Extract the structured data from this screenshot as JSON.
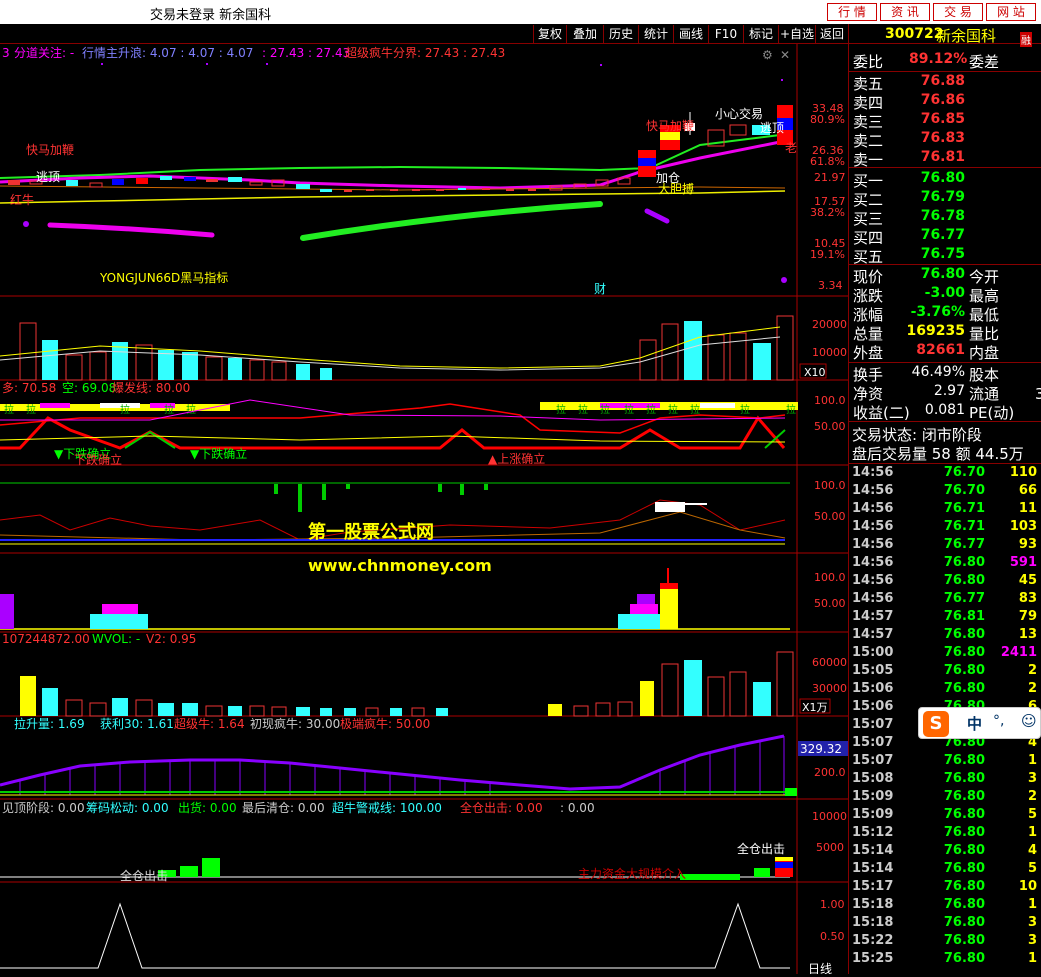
{
  "window": {
    "title": "交易未登录  新余国科",
    "top_buttons": [
      "行 情",
      "资 讯",
      "交 易",
      "网 站"
    ]
  },
  "toolbar": {
    "buttons": [
      "复权",
      "叠加",
      "历史",
      "统计",
      "画线",
      "F10",
      "标记",
      "+自选",
      "返回"
    ]
  },
  "panel1": {
    "legend_num": "3",
    "legend_a": "分道关注: -",
    "legend_b": "行情主升浪: 4.07 : 4.07 : 4.07",
    "legend_c": ": 27.43 : 27.43",
    "legend_d": "超级疯牛分界: 27.43 : 27.43",
    "axis": [
      "33.48",
      "80.9%",
      "26.36",
      "61.8%",
      "21.97",
      "17.57",
      "38.2%",
      "10.45",
      "19.1%",
      "3.34"
    ],
    "indicator_name": "YONGJUN66D黑马指标",
    "cai": "财",
    "annotations": {
      "kuaima_left": "快马加鞭",
      "taoding_left": "逃顶",
      "hongniu": "红牛",
      "kuaima_right": "快马加鞭",
      "xiaoxin": "小心交易",
      "taoding_right": "逃顶",
      "jiacang": "加仓",
      "dadanbo": "大胆搏",
      "lao": "老"
    }
  },
  "panel2": {
    "axis": [
      "20000",
      "10000"
    ],
    "unit": "X10"
  },
  "panel3": {
    "legend_a": "多: 70.58",
    "legend_b": "空: 69.08",
    "legend_c": "爆发线: 80.00",
    "axis": [
      "100.0",
      "50.00"
    ],
    "tag_la": "拉",
    "down_a": "下跌确立",
    "down_b": "下跌确立",
    "down_c": "下跌确立",
    "up_a": "上涨确立"
  },
  "panel4": {
    "axis": [
      "100.0",
      "50.00"
    ],
    "watermark_a": "第一股票公式网",
    "watermark_b": "www.chnmoney.com"
  },
  "panel5": {
    "axis": [
      "100.0",
      "50.00"
    ]
  },
  "panel6": {
    "legend_a": "107244872.00",
    "legend_b": "WVOL: -",
    "legend_c": "V2: 0.95",
    "axis": [
      "60000",
      "30000"
    ],
    "unit": "X1万"
  },
  "panel7": {
    "legend_a": "拉升量: 1.69",
    "legend_b": "获利30: 1.61",
    "legend_c": "超级牛: 1.64",
    "legend_d": "初现疯牛: 30.00",
    "legend_e": "极端疯牛: 50.00",
    "axis_box": "329.32",
    "axis": [
      "200.0"
    ]
  },
  "panel8": {
    "legend_a": "见顶阶段: 0.00",
    "legend_b": "筹码松动: 0.00",
    "legend_c": "出货: 0.00",
    "legend_d": "最后清仓: 0.00",
    "legend_e": "超牛警戒线: 100.00",
    "legend_f": "全仓出击: 0.00",
    "legend_g": ": 0.00",
    "axis": [
      "10000",
      "5000"
    ],
    "quancang_left": "全仓出击",
    "quancang_right": "全仓出击",
    "zhuli": "主力资金大规模介入"
  },
  "panel9": {
    "axis": [
      "1.00",
      "0.50"
    ],
    "corner": "日线"
  },
  "quote": {
    "code": "300722",
    "name": "新余国科",
    "badge": "融",
    "weibi_label": "委比",
    "weibi_val": "89.12%",
    "weicha_label": "委差",
    "asks": [
      {
        "label": "卖五",
        "price": "76.88"
      },
      {
        "label": "卖四",
        "price": "76.86"
      },
      {
        "label": "卖三",
        "price": "76.85"
      },
      {
        "label": "卖二",
        "price": "76.83"
      },
      {
        "label": "卖一",
        "price": "76.81"
      }
    ],
    "bids": [
      {
        "label": "买一",
        "price": "76.80"
      },
      {
        "label": "买二",
        "price": "76.79"
      },
      {
        "label": "买三",
        "price": "76.78"
      },
      {
        "label": "买四",
        "price": "76.77"
      },
      {
        "label": "买五",
        "price": "76.75"
      }
    ],
    "stats": [
      {
        "l1": "现价",
        "v1": "76.80",
        "l2": "今开",
        "color": "#0f0"
      },
      {
        "l1": "涨跌",
        "v1": "-3.00",
        "l2": "最高",
        "color": "#0f0"
      },
      {
        "l1": "涨幅",
        "v1": "-3.76%",
        "l2": "最低",
        "color": "#0f0"
      },
      {
        "l1": "总量",
        "v1": "169235",
        "l2": "量比",
        "color": "#ff0"
      },
      {
        "l1": "外盘",
        "v1": "82661",
        "l2": "内盘",
        "color": "#f33"
      }
    ],
    "stats2": [
      {
        "l1": "换手",
        "v1": "46.49%",
        "l2": "股本"
      },
      {
        "l1": "净资",
        "v1": "2.97",
        "l2": "流通"
      },
      {
        "l1": "收益(二)",
        "v1": "0.081",
        "l2": "PE(动)"
      }
    ],
    "liutong_extra": "3",
    "trade_status": "交易状态: 闭市阶段",
    "after_hours": "盘后交易量 58 额 44.5万"
  },
  "ticks": [
    {
      "t": "14:56",
      "p": "76.70",
      "v": "110",
      "vc": "#ff0"
    },
    {
      "t": "14:56",
      "p": "76.70",
      "v": "66",
      "vc": "#ff0"
    },
    {
      "t": "14:56",
      "p": "76.71",
      "v": "11",
      "vc": "#ff0"
    },
    {
      "t": "14:56",
      "p": "76.71",
      "v": "103",
      "vc": "#ff0"
    },
    {
      "t": "14:56",
      "p": "76.77",
      "v": "93",
      "vc": "#ff0"
    },
    {
      "t": "14:56",
      "p": "76.80",
      "v": "591",
      "vc": "#f0f"
    },
    {
      "t": "14:56",
      "p": "76.80",
      "v": "45",
      "vc": "#ff0"
    },
    {
      "t": "14:56",
      "p": "76.77",
      "v": "83",
      "vc": "#ff0"
    },
    {
      "t": "14:57",
      "p": "76.81",
      "v": "79",
      "vc": "#ff0"
    },
    {
      "t": "14:57",
      "p": "76.80",
      "v": "13",
      "vc": "#ff0"
    },
    {
      "t": "15:00",
      "p": "76.80",
      "v": "2411",
      "vc": "#f0f"
    },
    {
      "t": "15:05",
      "p": "76.80",
      "v": "2",
      "vc": "#ff0"
    },
    {
      "t": "15:06",
      "p": "76.80",
      "v": "2",
      "vc": "#ff0"
    },
    {
      "t": "15:06",
      "p": "76.80",
      "v": "6",
      "vc": "#ff0"
    },
    {
      "t": "15:07",
      "p": "76.80",
      "v": "",
      "vc": "#ff0"
    },
    {
      "t": "15:07",
      "p": "76.80",
      "v": "4",
      "vc": "#ff0"
    },
    {
      "t": "15:07",
      "p": "76.80",
      "v": "1",
      "vc": "#ff0"
    },
    {
      "t": "15:08",
      "p": "76.80",
      "v": "3",
      "vc": "#ff0"
    },
    {
      "t": "15:09",
      "p": "76.80",
      "v": "2",
      "vc": "#ff0"
    },
    {
      "t": "15:09",
      "p": "76.80",
      "v": "5",
      "vc": "#ff0"
    },
    {
      "t": "15:12",
      "p": "76.80",
      "v": "1",
      "vc": "#ff0"
    },
    {
      "t": "15:14",
      "p": "76.80",
      "v": "4",
      "vc": "#ff0"
    },
    {
      "t": "15:14",
      "p": "76.80",
      "v": "5",
      "vc": "#ff0"
    },
    {
      "t": "15:17",
      "p": "76.80",
      "v": "10",
      "vc": "#ff0"
    },
    {
      "t": "15:18",
      "p": "76.80",
      "v": "1",
      "vc": "#ff0"
    },
    {
      "t": "15:18",
      "p": "76.80",
      "v": "3",
      "vc": "#ff0"
    },
    {
      "t": "15:22",
      "p": "76.80",
      "v": "3",
      "vc": "#ff0"
    },
    {
      "t": "15:25",
      "p": "76.80",
      "v": "1",
      "vc": "#ff0"
    }
  ],
  "ime": {
    "label": "中",
    "punct": "°,"
  }
}
